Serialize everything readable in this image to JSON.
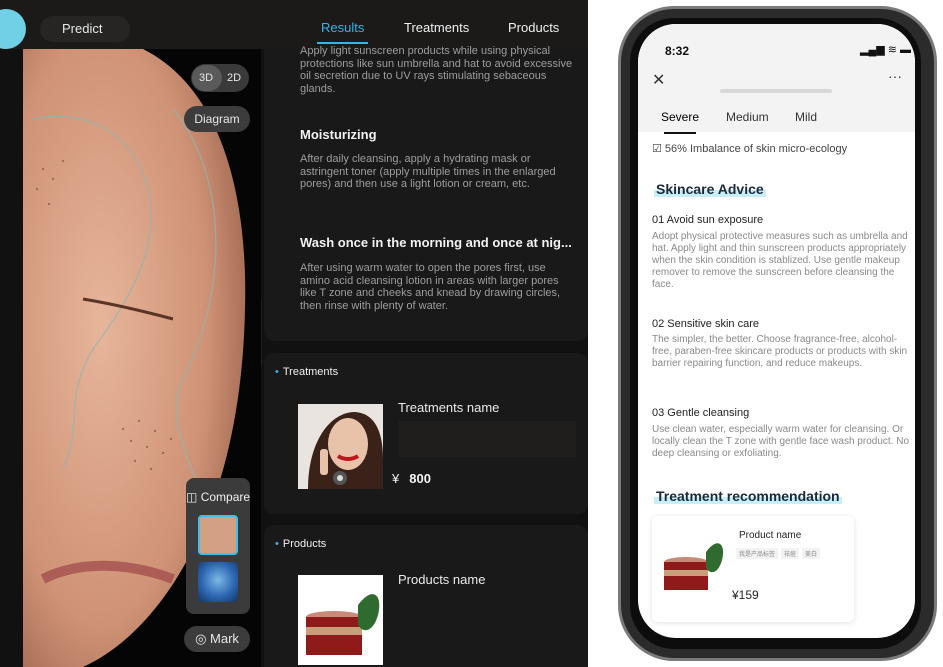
{
  "tablet": {
    "predict_label": "Predict",
    "tabs": [
      "Results",
      "Treatments",
      "Products"
    ],
    "view_toggle": {
      "opt_3d": "3D",
      "opt_2d": "2D"
    },
    "diagram_label": "Diagram",
    "compare_label": "Compare",
    "mark_label": "Mark",
    "advice": {
      "intro_text": "Apply light sunscreen products while using physical protections like sun umbrella and hat to avoid excessive oil secretion due to UV rays stimulating sebaceous glands.",
      "items": [
        {
          "title": "Moisturizing",
          "text": "After daily cleansing, apply a hydrating mask or astringent toner (apply multiple times in the enlarged pores) and then use a light lotion or cream, etc."
        },
        {
          "title": "Wash once in the morning and once at nig...",
          "text": "After using warm water to open the pores first, use amino acid cleansing lotion in areas with larger pores like T zone and cheeks and knead by drawing circles, then rinse with plenty of water."
        }
      ]
    },
    "treatments": {
      "section_label": "Treatments",
      "item_name": "Treatments name",
      "currency": "¥",
      "price": "800"
    },
    "products": {
      "section_label": "Products",
      "item_name": "Products name"
    }
  },
  "phone": {
    "time": "8:32",
    "status_icons": "▂▄▆ ≋ ▬",
    "close_icon": "✕",
    "more_icon": "···",
    "severity_tabs": [
      "Severe",
      "Medium",
      "Mild"
    ],
    "summary_line": "☑ 56% Imbalance of skin micro-ecology",
    "skincare_heading": "Skincare Advice",
    "advice_items": [
      {
        "title": "01 Avoid sun exposure",
        "text": "Adopt physical protective measures such as umbrella and hat. Apply light and thin sunscreen products appropriately when the skin condition is stablized. Use gentle makeup remover to remove the sunscreen before cleansing the face."
      },
      {
        "title": "02 Sensitive skin care",
        "text": "The simpler, the better. Choose fragrance-free, alcohol-free, paraben-free skincare products or products with skin barrier repairing function, and reduce makeups."
      },
      {
        "title": "03 Gentle cleansing",
        "text": "Use clean water, especially warm water for cleansing. Or locally clean the T zone with gentle face wash product. No deep cleansing or exfoliating."
      }
    ],
    "treatment_heading": "Treatment recommendation",
    "product": {
      "name": "Product name",
      "tags": [
        "我是产品标签",
        "祛痘",
        "美白"
      ],
      "price": "¥159"
    }
  },
  "colors": {
    "accent": "#35b4e6",
    "panel": "#1a1919",
    "highlight": "#c8eef8"
  }
}
